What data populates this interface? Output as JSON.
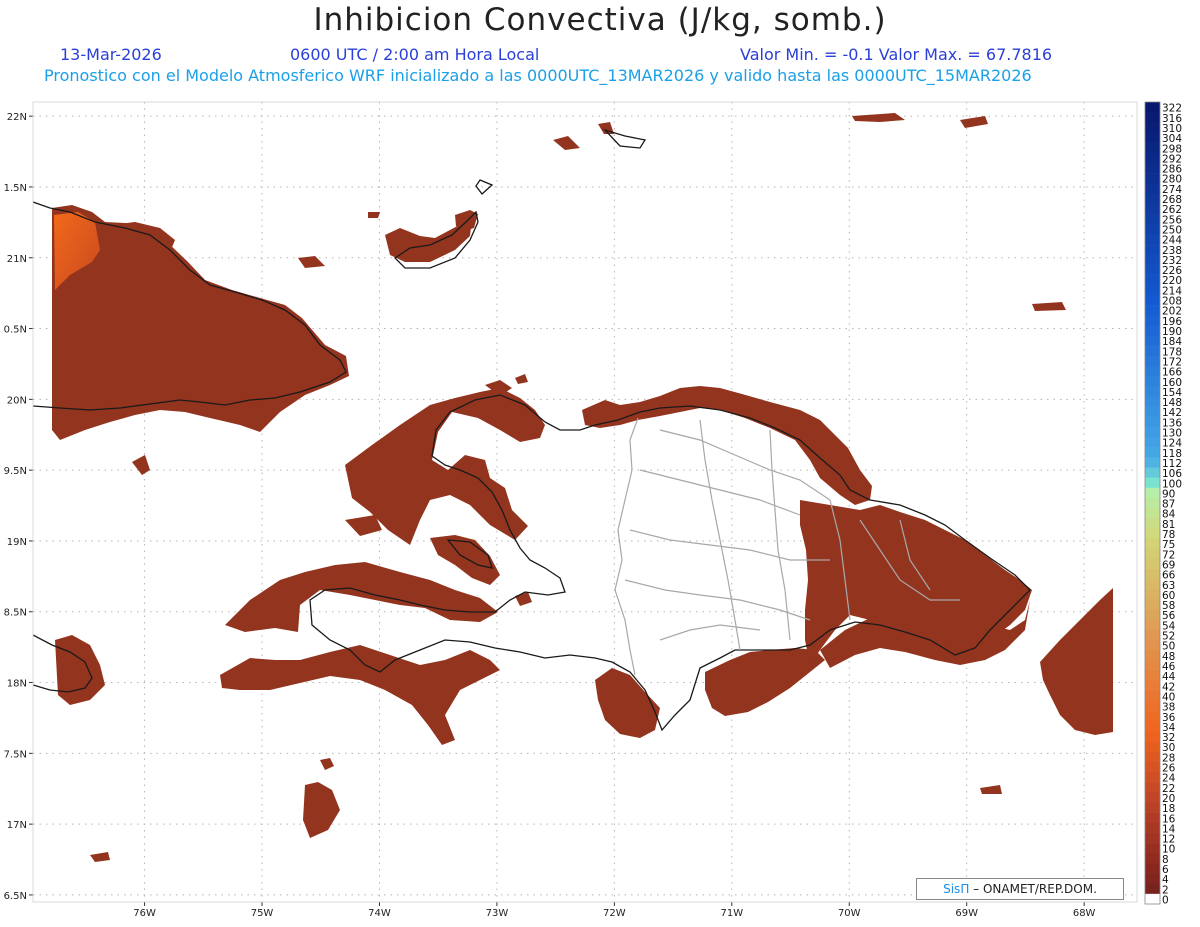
{
  "header": {
    "title": "Inhibicion Convectiva (J/kg, somb.)",
    "date": "13-Mar-2026",
    "time": "0600 UTC / 2:00 am Hora Local",
    "min_max": "Valor Min. = -0.1  Valor Max. = 67.7816",
    "description": "Pronostico con el Modelo Atmosferico WRF inicializado a las 0000UTC_13MAR2026 y valido hasta las  0000UTC_15MAR2026"
  },
  "chart_data": {
    "type": "heatmap",
    "title": "Inhibicion Convectiva (J/kg, somb.)",
    "value_min": -0.1,
    "value_max": 67.7816,
    "lat_ticks": [
      "22N",
      "1.5N",
      "21N",
      "0.5N",
      "20N",
      "9.5N",
      "19N",
      "8.5N",
      "18N",
      "7.5N",
      "17N",
      "6.5N"
    ],
    "lon_ticks": [
      "76W",
      "75W",
      "74W",
      "73W",
      "72W",
      "71W",
      "70W",
      "69W",
      "68W"
    ],
    "lat_values": [
      22,
      21.5,
      21,
      20.5,
      20,
      19.5,
      19,
      18.5,
      18,
      17.5,
      17,
      16.5
    ],
    "lon_values": [
      -76,
      -75,
      -74,
      -73,
      -72,
      -71,
      -70,
      -69,
      -68
    ],
    "lat_range": [
      16.45,
      22.1
    ],
    "lon_range": [
      -76.95,
      -67.55
    ],
    "grid": true,
    "colorbar": {
      "labels": [
        "322",
        "316",
        "310",
        "304",
        "298",
        "292",
        "286",
        "280",
        "274",
        "268",
        "262",
        "256",
        "250",
        "244",
        "238",
        "232",
        "226",
        "220",
        "214",
        "208",
        "202",
        "196",
        "190",
        "184",
        "178",
        "172",
        "166",
        "160",
        "154",
        "148",
        "142",
        "136",
        "130",
        "124",
        "118",
        "112",
        "106",
        "100",
        "90",
        "87",
        "84",
        "81",
        "78",
        "75",
        "72",
        "69",
        "66",
        "63",
        "60",
        "58",
        "56",
        "54",
        "52",
        "50",
        "48",
        "46",
        "44",
        "42",
        "40",
        "38",
        "36",
        "34",
        "32",
        "30",
        "28",
        "26",
        "24",
        "22",
        "20",
        "18",
        "16",
        "14",
        "12",
        "10",
        "8",
        "6",
        "4",
        "2",
        "0"
      ]
    }
  },
  "credit": {
    "sis": "SisΠ",
    "rest": "– ONAMET/REP.DOM."
  },
  "colors": {
    "header_blue": "#2a3fd8",
    "header_cyan": "#1aa0e8",
    "field_main": "#93341f",
    "field_hot": "#f05a18"
  }
}
